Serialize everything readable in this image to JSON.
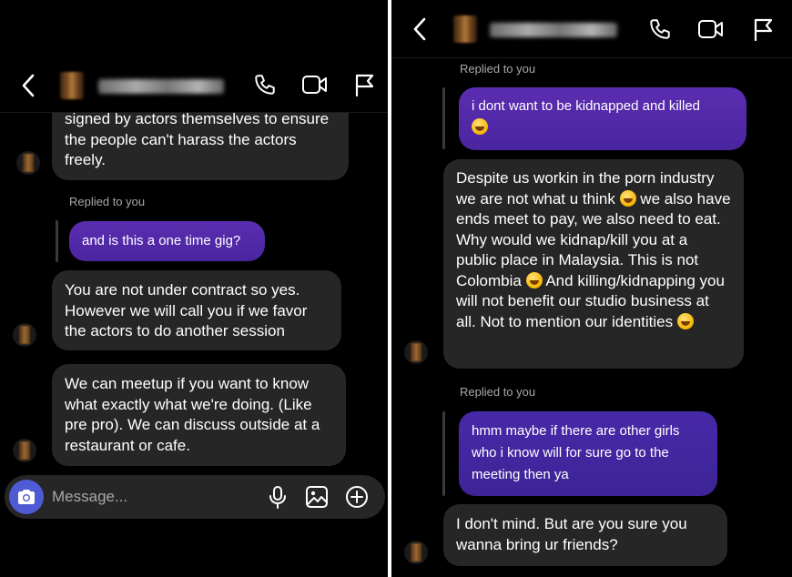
{
  "left": {
    "header": {
      "contact_name": "hidden_username"
    },
    "messages": {
      "m1": "signed by actors themselves to ensure the people can't harass the actors freely.",
      "replied1": "Replied to you",
      "reply1": "and is this a one time gig?",
      "m2": "You are not under contract so yes. However we will call you if we favor the actors to do another session",
      "m3": "We can meetup if you want to know what exactly what we're doing. (Like pre pro). We can discuss outside at a restaurant or cafe."
    },
    "composer": {
      "placeholder": "Message..."
    }
  },
  "right": {
    "header": {
      "contact_name": "hidden_username"
    },
    "messages": {
      "replied0": "Replied to you",
      "reply0": "i dont want to be kidnapped and killed",
      "m1": "Despite us workin in the porn industry we are not what u think",
      "m1b": "we also have ends meet to pay, we also need to eat. Why would we kidnap/kill you at a public place in Malaysia. This is not Colombia",
      "m1c": "And killing/kidnapping you will not benefit our studio business at all. Not to mention our identities",
      "replied2": "Replied to you",
      "reply2": "hmm maybe if there are other girls who i know will for sure go to the meeting then ya",
      "m2": "I don't mind. But are you sure you wanna bring ur friends?"
    }
  },
  "colors": {
    "background": "#000000",
    "incoming_bubble": "#262626",
    "outgoing_bubble": "#5b2db0",
    "camera_button": "#4f5bd5"
  },
  "icons": [
    "back-chevron-icon",
    "phone-icon",
    "video-icon",
    "flag-icon",
    "camera-icon",
    "microphone-icon",
    "image-icon",
    "plus-icon",
    "emoji-icon"
  ]
}
